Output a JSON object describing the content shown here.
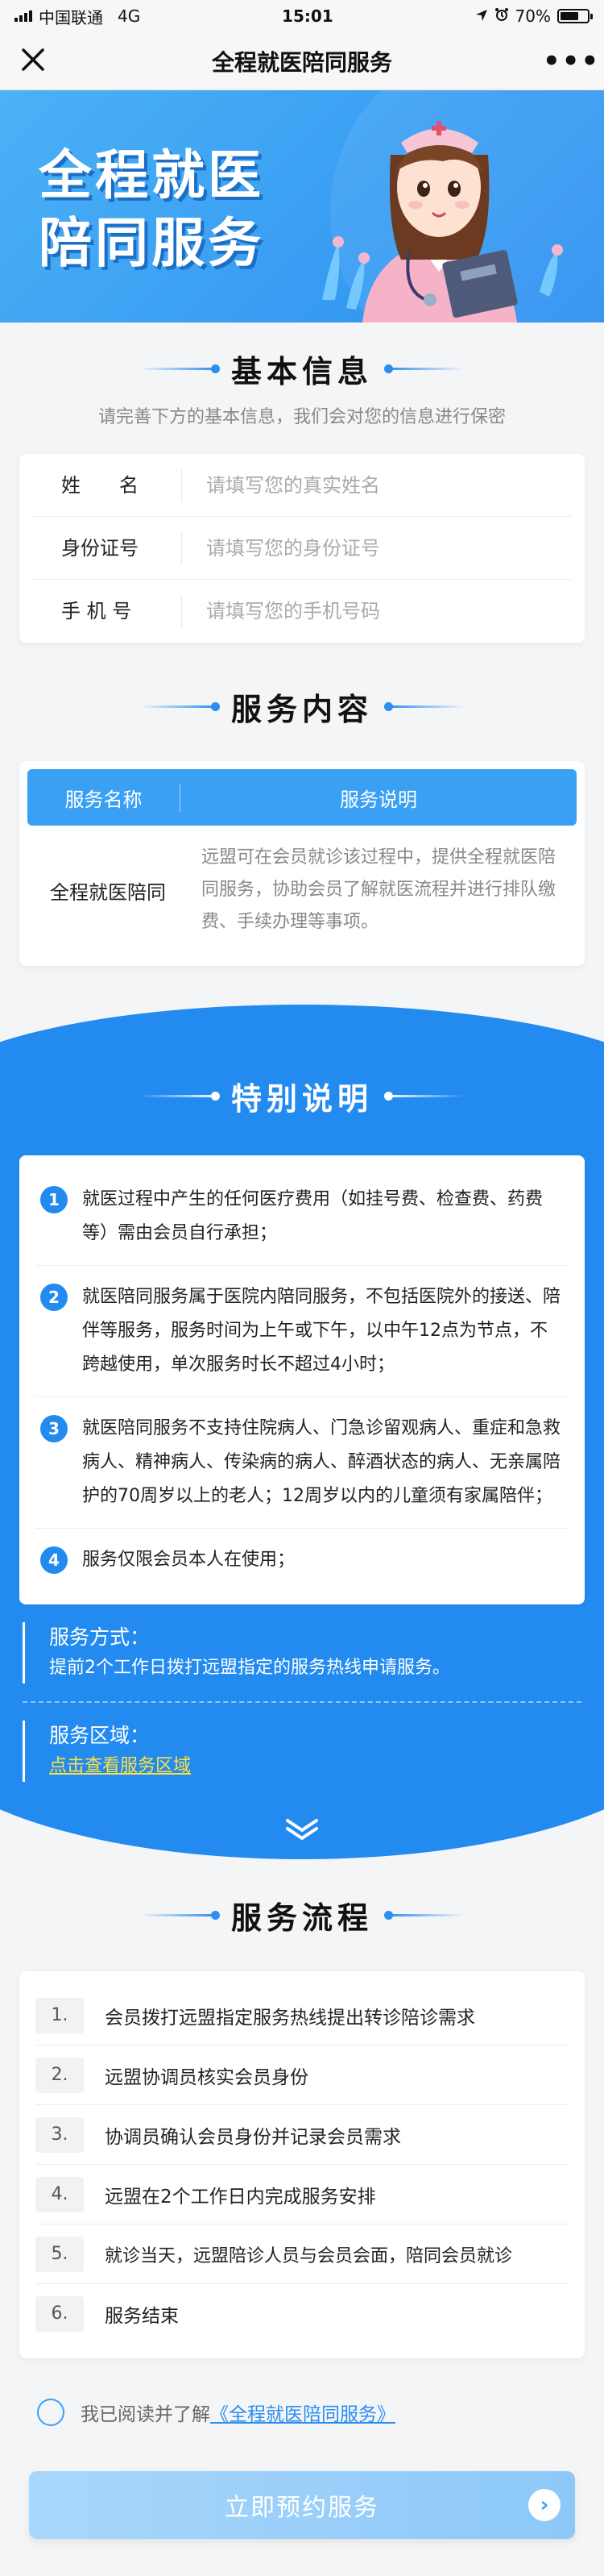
{
  "status_bar": {
    "carrier": "中国联通",
    "network": "4G",
    "time": "15:01",
    "battery": "70%"
  },
  "nav": {
    "title": "全程就医陪同服务",
    "more": "•••"
  },
  "banner": {
    "title_line1": "全程就医",
    "title_line2": "陪同服务"
  },
  "basic_info": {
    "title": "基本信息",
    "hint": "请完善下方的基本信息，我们会对您的信息进行保密",
    "fields": [
      {
        "label": "姓　　名",
        "placeholder": "请填写您的真实姓名"
      },
      {
        "label": "身份证号",
        "placeholder": "请填写您的身份证号"
      },
      {
        "label": "手 机 号",
        "placeholder": "请填写您的手机号码"
      }
    ]
  },
  "service": {
    "title": "服务内容",
    "col_name": "服务名称",
    "col_desc": "服务说明",
    "row_name": "全程就医陪同",
    "row_desc": "远盟可在会员就诊该过程中，提供全程就医陪同服务，协助会员了解就医流程并进行排队缴费、手续办理等事项。"
  },
  "special": {
    "title": "特别说明",
    "notes": [
      {
        "num": "1",
        "text": "就医过程中产生的任何医疗费用（如挂号费、检查费、药费等）需由会员自行承担；"
      },
      {
        "num": "2",
        "text": "就医陪同服务属于医院内陪同服务，不包括医院外的接送、陪伴等服务，服务时间为上午或下午，以中午12点为节点，不跨越使用，单次服务时长不超过4小时；"
      },
      {
        "num": "3",
        "text": "就医陪同服务不支持住院病人、门急诊留观病人、重症和急救病人、精神病人、传染病的病人、醉酒状态的病人、无亲属陪护的70周岁以上的老人；12周岁以内的儿童须有家属陪伴；"
      },
      {
        "num": "4",
        "text": "服务仅限会员本人在使用；"
      }
    ],
    "method_label": "服务方式：",
    "method_text": "提前2个工作日拨打远盟指定的服务热线申请服务。",
    "area_label": "服务区域：",
    "area_link": "点击查看服务区域"
  },
  "process": {
    "title": "服务流程",
    "steps": [
      {
        "num": "1.",
        "text": "会员拨打远盟指定服务热线提出转诊陪诊需求"
      },
      {
        "num": "2.",
        "text": "远盟协调员核实会员身份"
      },
      {
        "num": "3.",
        "text": "协调员确认会员身份并记录会员需求"
      },
      {
        "num": "4.",
        "text": "远盟在2个工作日内完成服务安排"
      },
      {
        "num": "5.",
        "text": "就诊当天，远盟陪诊人员与会员会面，陪同会员就诊"
      },
      {
        "num": "6.",
        "text": "服务结束"
      }
    ]
  },
  "agreement": {
    "prefix": "我已阅读并了解",
    "link": "《全程就医陪同服务》"
  },
  "submit": {
    "label": "立即预约服务",
    "arrow": "›"
  },
  "colors": {
    "primary": "#238bf0",
    "accent_link": "#ffe23d",
    "button": "#8cc8f8"
  },
  "icons": {
    "signal": "signal-bars-icon",
    "location": "location-arrow-icon",
    "alarm": "alarm-icon",
    "battery": "battery-icon",
    "close": "close-icon",
    "more": "more-icon",
    "chevron": "double-chevron-down-icon"
  }
}
